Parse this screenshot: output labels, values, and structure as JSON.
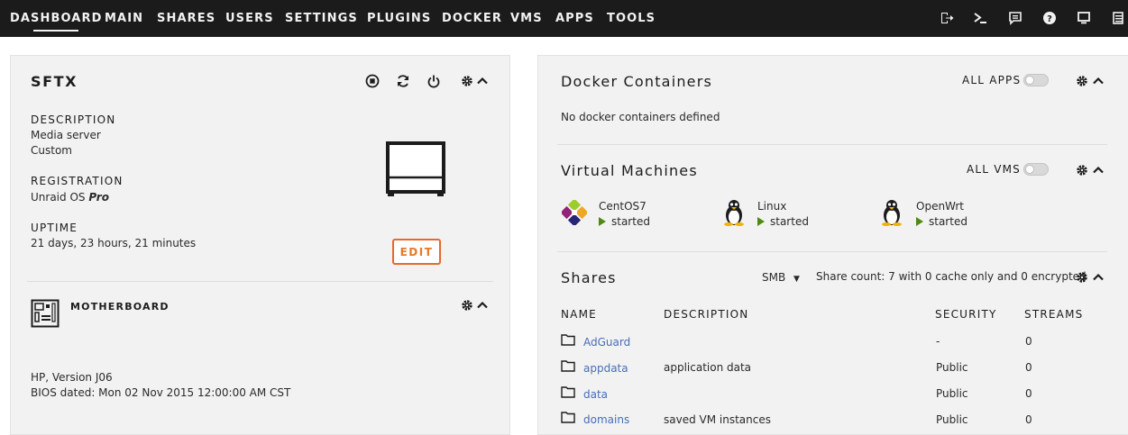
{
  "nav": {
    "tabs": [
      "DASHBOARD",
      "MAIN",
      "SHARES",
      "USERS",
      "SETTINGS",
      "PLUGINS",
      "DOCKER",
      "VMS",
      "APPS",
      "TOOLS"
    ],
    "active_tab": "DASHBOARD",
    "icons": [
      "logout-icon",
      "terminal-icon",
      "feedback-icon",
      "help-icon",
      "monitor-icon",
      "log-icon"
    ]
  },
  "server": {
    "name": "SFTX",
    "description_label": "DESCRIPTION",
    "description_line1": "Media server",
    "description_line2": "Custom",
    "registration_label": "REGISTRATION",
    "registration_prefix": "Unraid OS",
    "registration_level": "Pro",
    "uptime_label": "UPTIME",
    "uptime_value": "21 days, 23 hours, 21 minutes",
    "edit_label": "EDIT"
  },
  "motherboard": {
    "title": "MOTHERBOARD",
    "model": "HP, Version J06",
    "bios": "BIOS dated: Mon 02 Nov 2015 12:00:00 AM CST"
  },
  "docker": {
    "title": "Docker Containers",
    "toggle_label": "ALL APPS",
    "empty_text": "No docker containers defined"
  },
  "vms": {
    "title": "Virtual Machines",
    "toggle_label": "ALL VMS",
    "items": [
      {
        "name": "CentOS7",
        "status": "started",
        "icon": "centos-icon"
      },
      {
        "name": "Linux",
        "status": "started",
        "icon": "tux-icon"
      },
      {
        "name": "OpenWrt",
        "status": "started",
        "icon": "tux-icon"
      }
    ]
  },
  "shares": {
    "title": "Shares",
    "protocol": "SMB",
    "count_text": "Share count: 7 with 0 cache only and 0 encrypted",
    "columns": [
      "NAME",
      "DESCRIPTION",
      "SECURITY",
      "STREAMS"
    ],
    "rows": [
      {
        "name": "AdGuard",
        "description": "",
        "security": "-",
        "streams": "0"
      },
      {
        "name": "appdata",
        "description": "application data",
        "security": "Public",
        "streams": "0"
      },
      {
        "name": "data",
        "description": "",
        "security": "Public",
        "streams": "0"
      },
      {
        "name": "domains",
        "description": "saved VM instances",
        "security": "Public",
        "streams": "0"
      }
    ]
  },
  "colors": {
    "nav_bg": "#1c1b1b",
    "panel_bg": "#f2f2f2",
    "link": "#486dba",
    "edit_border": "#e8682a",
    "status_green": "#4f8a10"
  }
}
